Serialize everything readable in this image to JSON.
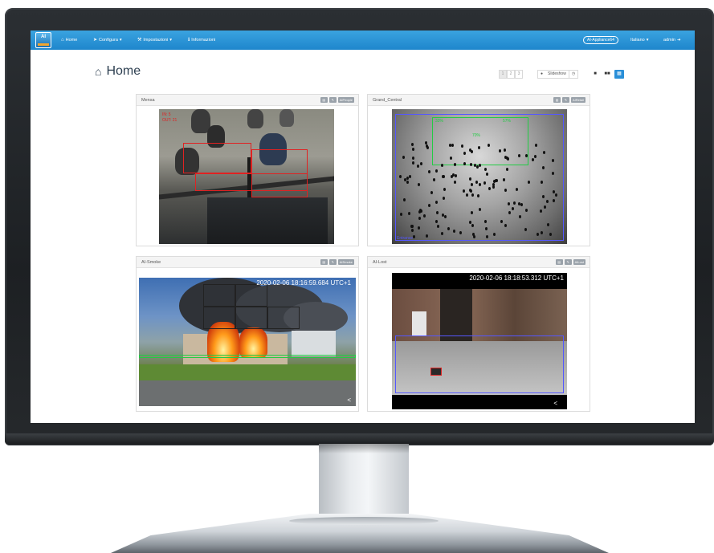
{
  "navbar": {
    "logo_text": "AI",
    "items": [
      {
        "label": "Home",
        "icon": "home-icon"
      },
      {
        "label": "Configura",
        "icon": "rocket-icon",
        "caret": "▾"
      },
      {
        "label": "Impostazioni",
        "icon": "wrench-icon",
        "caret": "▾"
      },
      {
        "label": "Informazioni",
        "icon": "info-icon"
      }
    ],
    "badge": "AI-Appliance64",
    "language": "Italiano",
    "user": "admin"
  },
  "page": {
    "title": "Home",
    "pages": [
      "1",
      "2",
      "3"
    ],
    "slideshow_label": "Slideshow"
  },
  "panels": [
    {
      "title": "Mensa",
      "tag": "AIPeople",
      "overlay_lines": [
        "IN: 5",
        "OUT: 21"
      ]
    },
    {
      "title": "Grand_Central",
      "tag": "AIRetail",
      "overlay_lines": [
        "33%",
        "57%",
        "70%",
        "Entrance"
      ]
    },
    {
      "title": "AI-Smoke",
      "tag": "AISmoke",
      "timestamp": "2020-02-06 18:16:59.684 UTC+1"
    },
    {
      "title": "AI-Lost",
      "tag": "AILost",
      "timestamp": "2020-02-06 18:18:53.312 UTC+1"
    }
  ],
  "colors": {
    "navbar": "#1e86cc",
    "accent": "#2a8fd8",
    "detection_red": "#e02222",
    "zone_blue": "#5557ff",
    "zone_green": "#22cc44"
  }
}
